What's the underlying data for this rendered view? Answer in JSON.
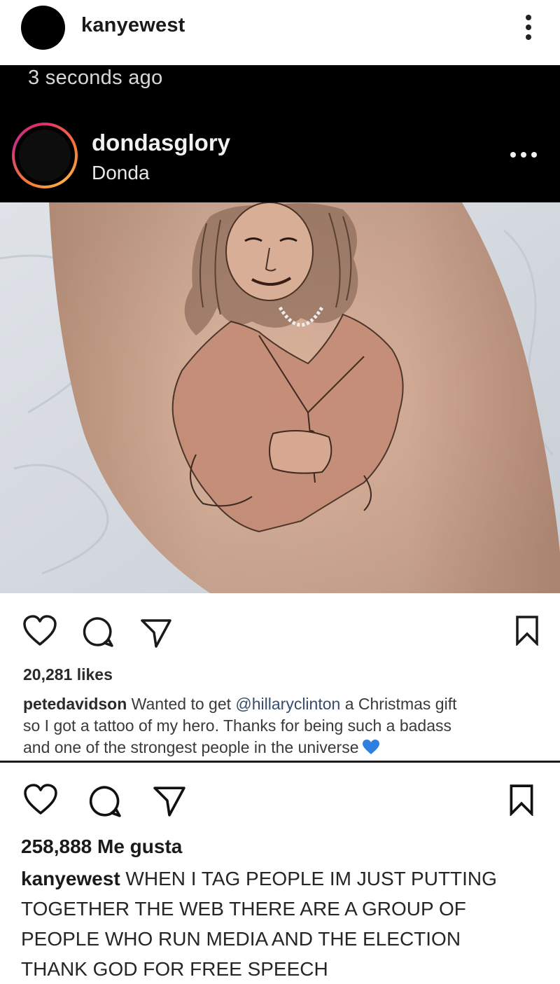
{
  "post": {
    "username": "kanyewest",
    "likes_text": "258,888 Me gusta",
    "caption_username": "kanyewest",
    "caption_lines": [
      "WHEN I TAG PEOPLE IM JUST PUTTING",
      "TOGETHER THE WEB  THERE ARE A GROUP OF",
      "PEOPLE WHO RUN MEDIA  AND THE ELECTION",
      "THANK GOD FOR FREE SPEECH"
    ],
    "more_icon": "vertical-ellipsis-icon"
  },
  "embedded": {
    "timestamp": "3 seconds ago",
    "username": "dondasglory",
    "location": "Donda",
    "likes_text": "20,281 likes",
    "caption_username": "petedavidson",
    "caption_part1": "Wanted to get",
    "caption_mention": "@hillaryclinton",
    "caption_part2": "a Christmas gift",
    "caption_line2": "so I got a tattoo of my hero. Thanks for being such a badass",
    "caption_line3": "and one of the strongest people in the universe",
    "emoji": "blue-heart-emoji",
    "more_icon": "horizontal-ellipsis-icon"
  },
  "icons": [
    "heart-icon",
    "comment-icon",
    "share-icon",
    "bookmark-icon"
  ],
  "colors": {
    "ring_gradient": [
      "#e1306c",
      "#f77737",
      "#fcaf45",
      "#c13584"
    ],
    "mention": "#384d6e",
    "blue_heart": "#2f7fe0"
  }
}
